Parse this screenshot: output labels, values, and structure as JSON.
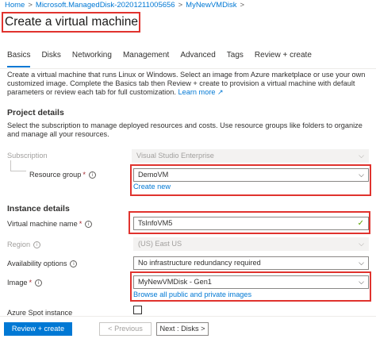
{
  "breadcrumb": {
    "home": "Home",
    "disk": "Microsoft.ManagedDisk-20201211005656",
    "vmdisk": "MyNewVMDisk",
    "separator": ">"
  },
  "page_title": "Create a virtual machine",
  "tabs": [
    {
      "label": "Basics",
      "active": true
    },
    {
      "label": "Disks",
      "active": false
    },
    {
      "label": "Networking",
      "active": false
    },
    {
      "label": "Management",
      "active": false
    },
    {
      "label": "Advanced",
      "active": false
    },
    {
      "label": "Tags",
      "active": false
    },
    {
      "label": "Review + create",
      "active": false
    }
  ],
  "intro": {
    "text": "Create a virtual machine that runs Linux or Windows. Select an image from Azure marketplace or use your own customized image. Complete the Basics tab then Review + create to provision a virtual machine with default parameters or review each tab for full customization.",
    "link": "Learn more",
    "link_icon": "external-link-icon"
  },
  "project_details": {
    "title": "Project details",
    "description": "Select the subscription to manage deployed resources and costs. Use resource groups like folders to organize and manage all your resources.",
    "subscription_label": "Subscription",
    "subscription_value": "Visual Studio Enterprise",
    "resource_group_label": "Resource group",
    "resource_group_value": "DemoVM",
    "create_new": "Create new"
  },
  "instance_details": {
    "title": "Instance details",
    "vm_name_label": "Virtual machine name",
    "vm_name_value": "TsInfoVM5",
    "region_label": "Region",
    "region_value": "(US) East US",
    "availability_label": "Availability options",
    "availability_value": "No infrastructure redundancy required",
    "image_label": "Image",
    "image_value": "MyNewVMDisk - Gen1",
    "browse_images": "Browse all public and private images",
    "spot_label": "Azure Spot instance"
  },
  "footer": {
    "review_create": "Review + create",
    "previous": "< Previous",
    "next": "Next : Disks >"
  },
  "symbols": {
    "required": "*",
    "info": "i",
    "chevron": "⌵",
    "check": "✓",
    "external": "↗"
  },
  "colors": {
    "accent": "#0078d4",
    "highlight": "#e0332e",
    "required": "#a4262c",
    "valid": "#57a300"
  }
}
